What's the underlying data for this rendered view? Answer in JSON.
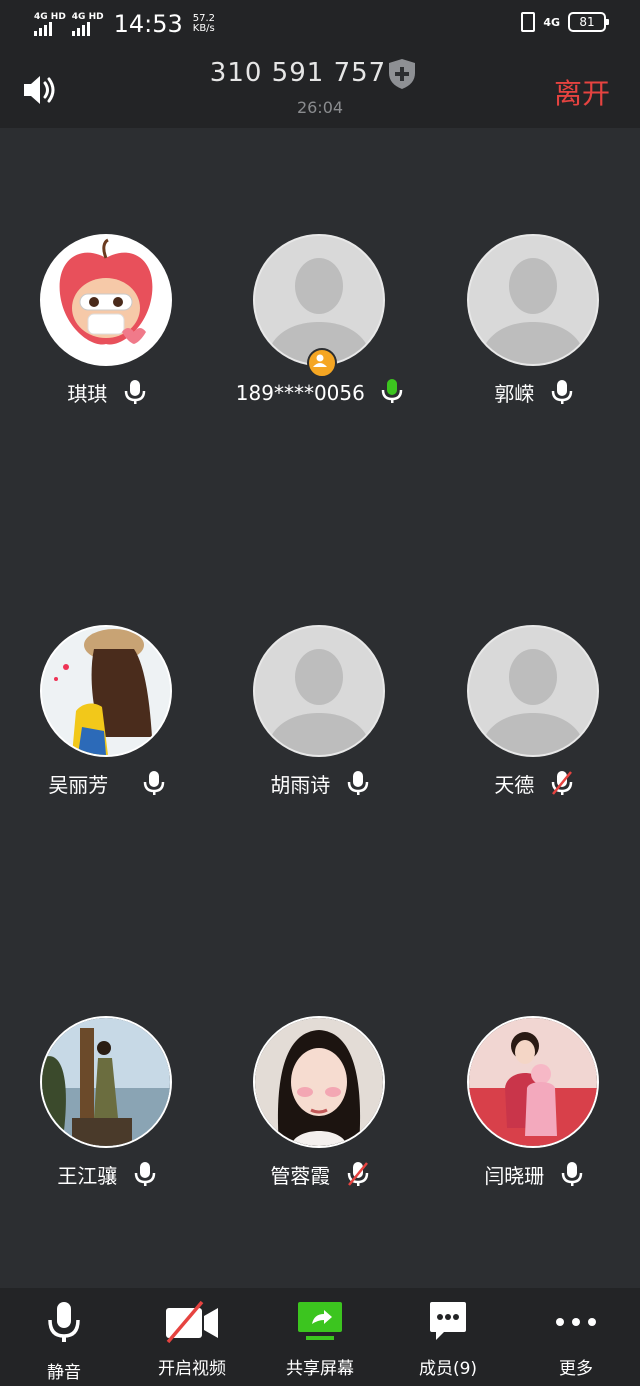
{
  "status_bar": {
    "sim1": "4G HD",
    "sim2": "4G HD",
    "time": "14:53",
    "speed_value": "57.2",
    "speed_unit": "KB/s",
    "network": "4G",
    "battery": "81"
  },
  "header": {
    "meeting_id": "310 591 757",
    "duration": "26:04",
    "leave_label": "离开"
  },
  "participants": [
    {
      "name": "琪琪",
      "mic": "on",
      "avatar": "photo"
    },
    {
      "name": "189****0056",
      "mic": "speaking",
      "avatar": "placeholder",
      "host": true
    },
    {
      "name": "郭嵘",
      "mic": "on",
      "avatar": "placeholder"
    },
    {
      "name": "吴丽芳",
      "mic": "on",
      "avatar": "photo"
    },
    {
      "name": "胡雨诗",
      "mic": "on",
      "avatar": "placeholder"
    },
    {
      "name": "天德",
      "mic": "muted",
      "avatar": "placeholder"
    },
    {
      "name": "王江骧",
      "mic": "on",
      "avatar": "photo"
    },
    {
      "name": "管蓉霞",
      "mic": "muted",
      "avatar": "photo"
    },
    {
      "name": "闫晓珊",
      "mic": "on",
      "avatar": "photo"
    }
  ],
  "toolbar": {
    "mute_label": "静音",
    "video_label": "开启视频",
    "share_label": "共享屏幕",
    "members_label": "成员(9)",
    "more_label": "更多"
  },
  "colors": {
    "background": "#2c2e31",
    "bar": "#232426",
    "leave": "#e64340",
    "speaking": "#3cc51f",
    "share": "#3cc51f",
    "host_badge": "#f5a623",
    "muted_slash": "#e64340"
  }
}
